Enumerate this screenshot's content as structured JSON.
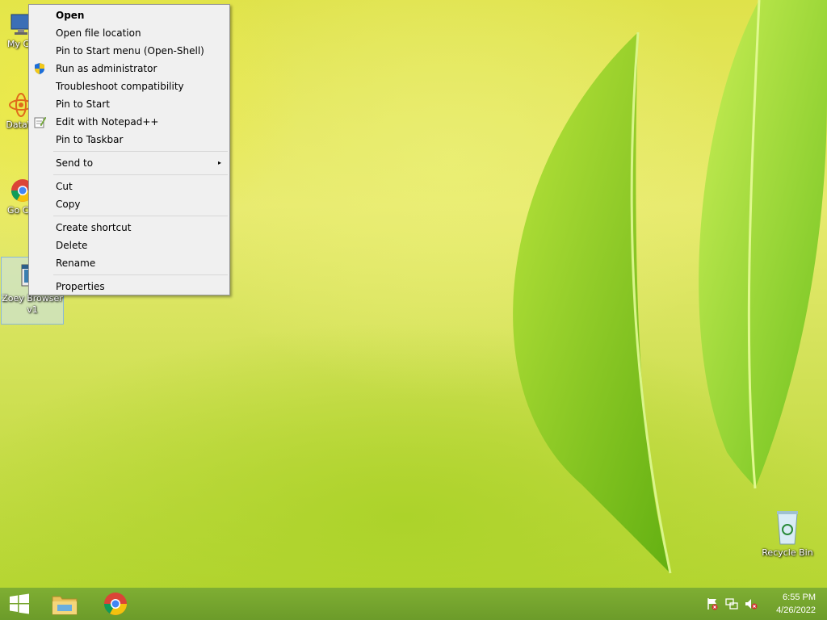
{
  "desktop": {
    "icons": [
      {
        "label": "My Co"
      },
      {
        "label": "DataW"
      },
      {
        "label": "Go Chr"
      },
      {
        "label": "Zoey Browser v1"
      },
      {
        "label": "Recycle Bin"
      }
    ]
  },
  "context_menu": {
    "items": [
      {
        "label": "Open"
      },
      {
        "label": "Open file location"
      },
      {
        "label": "Pin to Start menu (Open-Shell)"
      },
      {
        "label": "Run as administrator"
      },
      {
        "label": "Troubleshoot compatibility"
      },
      {
        "label": "Pin to Start"
      },
      {
        "label": "Edit with Notepad++"
      },
      {
        "label": "Pin to Taskbar"
      },
      {
        "label": "Send to"
      },
      {
        "label": "Cut"
      },
      {
        "label": "Copy"
      },
      {
        "label": "Create shortcut"
      },
      {
        "label": "Delete"
      },
      {
        "label": "Rename"
      },
      {
        "label": "Properties"
      }
    ],
    "submenu_arrow": "▸"
  },
  "taskbar": {
    "pinned": [
      "start-button",
      "file-explorer",
      "google-chrome"
    ],
    "tray_icons": [
      "action-center-flag-icon",
      "network-icon",
      "volume-muted-icon"
    ],
    "clock": {
      "time": "6:55 PM",
      "date": "4/26/2022"
    }
  },
  "colors": {
    "menu_bg": "#f0f0f0",
    "taskbar_bg": "#6e9e28",
    "selection": "#c8e1f5"
  }
}
